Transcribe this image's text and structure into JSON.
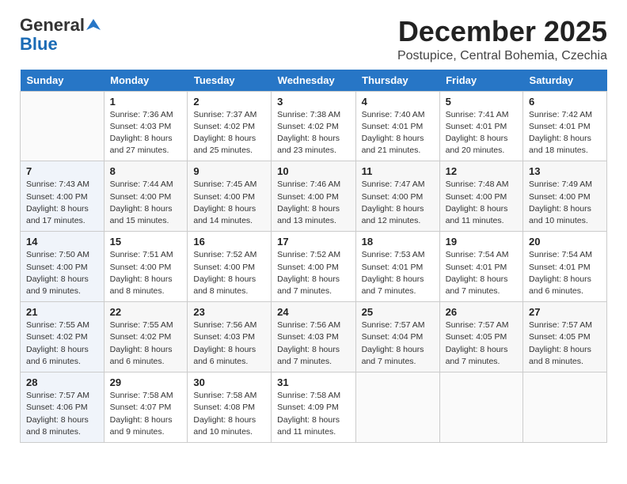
{
  "logo": {
    "line1": "General",
    "line2": "Blue"
  },
  "title": "December 2025",
  "location": "Postupice, Central Bohemia, Czechia",
  "header": {
    "days": [
      "Sunday",
      "Monday",
      "Tuesday",
      "Wednesday",
      "Thursday",
      "Friday",
      "Saturday"
    ]
  },
  "weeks": [
    [
      {
        "day": "",
        "info": ""
      },
      {
        "day": "1",
        "info": "Sunrise: 7:36 AM\nSunset: 4:03 PM\nDaylight: 8 hours\nand 27 minutes."
      },
      {
        "day": "2",
        "info": "Sunrise: 7:37 AM\nSunset: 4:02 PM\nDaylight: 8 hours\nand 25 minutes."
      },
      {
        "day": "3",
        "info": "Sunrise: 7:38 AM\nSunset: 4:02 PM\nDaylight: 8 hours\nand 23 minutes."
      },
      {
        "day": "4",
        "info": "Sunrise: 7:40 AM\nSunset: 4:01 PM\nDaylight: 8 hours\nand 21 minutes."
      },
      {
        "day": "5",
        "info": "Sunrise: 7:41 AM\nSunset: 4:01 PM\nDaylight: 8 hours\nand 20 minutes."
      },
      {
        "day": "6",
        "info": "Sunrise: 7:42 AM\nSunset: 4:01 PM\nDaylight: 8 hours\nand 18 minutes."
      }
    ],
    [
      {
        "day": "7",
        "info": "Sunrise: 7:43 AM\nSunset: 4:00 PM\nDaylight: 8 hours\nand 17 minutes."
      },
      {
        "day": "8",
        "info": "Sunrise: 7:44 AM\nSunset: 4:00 PM\nDaylight: 8 hours\nand 15 minutes."
      },
      {
        "day": "9",
        "info": "Sunrise: 7:45 AM\nSunset: 4:00 PM\nDaylight: 8 hours\nand 14 minutes."
      },
      {
        "day": "10",
        "info": "Sunrise: 7:46 AM\nSunset: 4:00 PM\nDaylight: 8 hours\nand 13 minutes."
      },
      {
        "day": "11",
        "info": "Sunrise: 7:47 AM\nSunset: 4:00 PM\nDaylight: 8 hours\nand 12 minutes."
      },
      {
        "day": "12",
        "info": "Sunrise: 7:48 AM\nSunset: 4:00 PM\nDaylight: 8 hours\nand 11 minutes."
      },
      {
        "day": "13",
        "info": "Sunrise: 7:49 AM\nSunset: 4:00 PM\nDaylight: 8 hours\nand 10 minutes."
      }
    ],
    [
      {
        "day": "14",
        "info": "Sunrise: 7:50 AM\nSunset: 4:00 PM\nDaylight: 8 hours\nand 9 minutes."
      },
      {
        "day": "15",
        "info": "Sunrise: 7:51 AM\nSunset: 4:00 PM\nDaylight: 8 hours\nand 8 minutes."
      },
      {
        "day": "16",
        "info": "Sunrise: 7:52 AM\nSunset: 4:00 PM\nDaylight: 8 hours\nand 8 minutes."
      },
      {
        "day": "17",
        "info": "Sunrise: 7:52 AM\nSunset: 4:00 PM\nDaylight: 8 hours\nand 7 minutes."
      },
      {
        "day": "18",
        "info": "Sunrise: 7:53 AM\nSunset: 4:01 PM\nDaylight: 8 hours\nand 7 minutes."
      },
      {
        "day": "19",
        "info": "Sunrise: 7:54 AM\nSunset: 4:01 PM\nDaylight: 8 hours\nand 7 minutes."
      },
      {
        "day": "20",
        "info": "Sunrise: 7:54 AM\nSunset: 4:01 PM\nDaylight: 8 hours\nand 6 minutes."
      }
    ],
    [
      {
        "day": "21",
        "info": "Sunrise: 7:55 AM\nSunset: 4:02 PM\nDaylight: 8 hours\nand 6 minutes."
      },
      {
        "day": "22",
        "info": "Sunrise: 7:55 AM\nSunset: 4:02 PM\nDaylight: 8 hours\nand 6 minutes."
      },
      {
        "day": "23",
        "info": "Sunrise: 7:56 AM\nSunset: 4:03 PM\nDaylight: 8 hours\nand 6 minutes."
      },
      {
        "day": "24",
        "info": "Sunrise: 7:56 AM\nSunset: 4:03 PM\nDaylight: 8 hours\nand 7 minutes."
      },
      {
        "day": "25",
        "info": "Sunrise: 7:57 AM\nSunset: 4:04 PM\nDaylight: 8 hours\nand 7 minutes."
      },
      {
        "day": "26",
        "info": "Sunrise: 7:57 AM\nSunset: 4:05 PM\nDaylight: 8 hours\nand 7 minutes."
      },
      {
        "day": "27",
        "info": "Sunrise: 7:57 AM\nSunset: 4:05 PM\nDaylight: 8 hours\nand 8 minutes."
      }
    ],
    [
      {
        "day": "28",
        "info": "Sunrise: 7:57 AM\nSunset: 4:06 PM\nDaylight: 8 hours\nand 8 minutes."
      },
      {
        "day": "29",
        "info": "Sunrise: 7:58 AM\nSunset: 4:07 PM\nDaylight: 8 hours\nand 9 minutes."
      },
      {
        "day": "30",
        "info": "Sunrise: 7:58 AM\nSunset: 4:08 PM\nDaylight: 8 hours\nand 10 minutes."
      },
      {
        "day": "31",
        "info": "Sunrise: 7:58 AM\nSunset: 4:09 PM\nDaylight: 8 hours\nand 11 minutes."
      },
      {
        "day": "",
        "info": ""
      },
      {
        "day": "",
        "info": ""
      },
      {
        "day": "",
        "info": ""
      }
    ]
  ]
}
